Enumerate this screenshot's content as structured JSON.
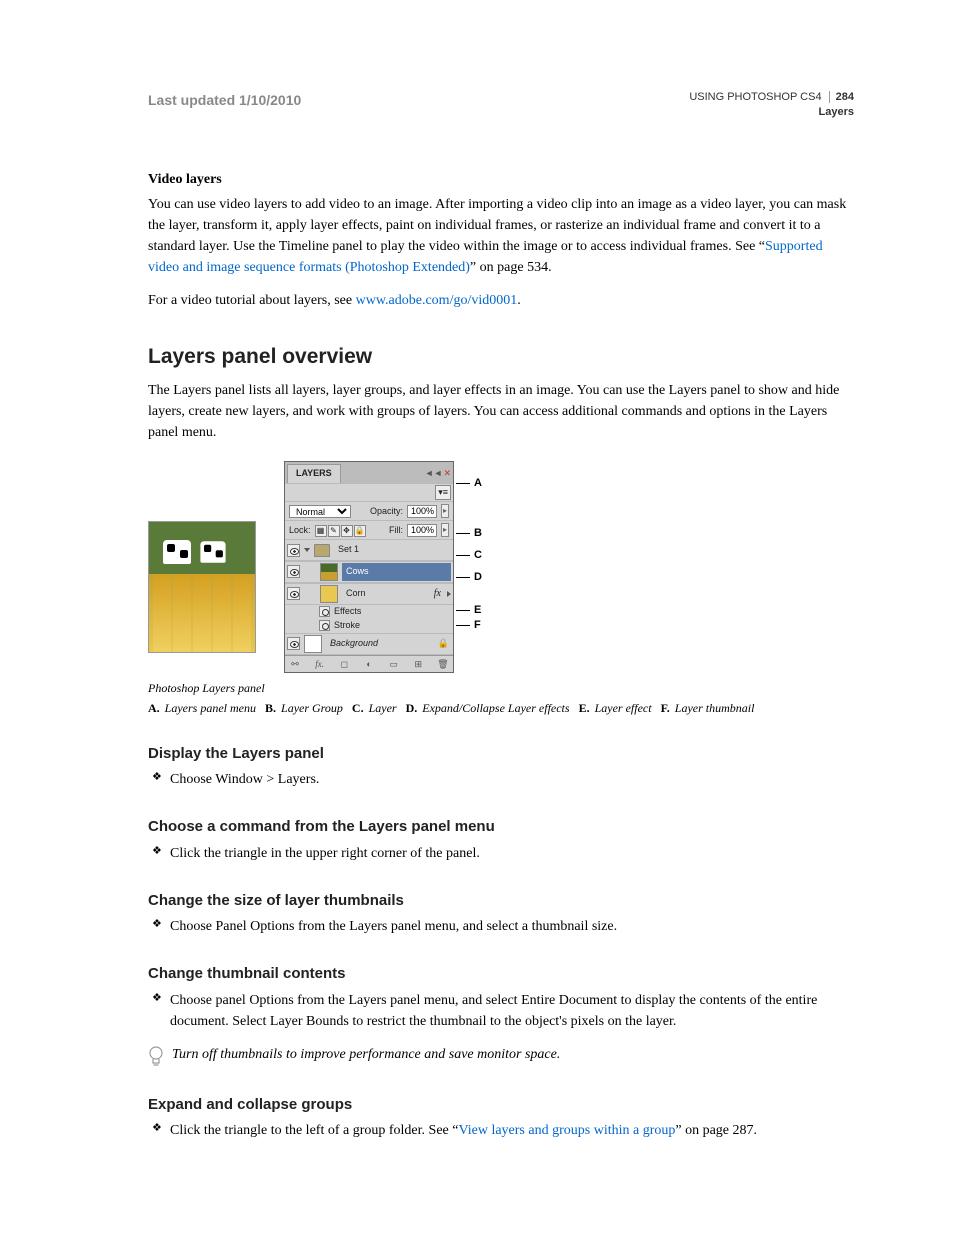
{
  "header": {
    "last_updated": "Last updated 1/10/2010",
    "doc_title": "USING PHOTOSHOP CS4",
    "page_number": "284",
    "section_name": "Layers"
  },
  "video_layers": {
    "heading": "Video layers",
    "para1_a": "You can use video layers to add video to an image. After importing a video clip into an image as a video layer, you can mask the layer, transform it, apply layer effects, paint on individual frames, or rasterize an individual frame and convert it to a standard layer. Use the Timeline panel to play the video within the image or to access individual frames. See “",
    "link1": "Supported video and image sequence formats (Photoshop Extended)",
    "para1_b": "” on page 534.",
    "para2_a": "For a video tutorial about layers, see ",
    "link2": "www.adobe.com/go/vid0001",
    "para2_b": "."
  },
  "overview": {
    "heading": "Layers panel overview",
    "para": "The Layers panel lists all layers, layer groups, and layer effects in an image. You can use the Layers panel to show and hide layers, create new layers, and work with groups of layers. You can access additional commands and options in the Layers panel menu."
  },
  "layers_panel": {
    "tab": "LAYERS",
    "blend_mode": "Normal",
    "opacity_label": "Opacity:",
    "opacity_value": "100%",
    "lock_label": "Lock:",
    "fill_label": "Fill:",
    "fill_value": "100%",
    "group_name": "Set 1",
    "layer_cows": "Cows",
    "layer_corn": "Corn",
    "effects_label": "Effects",
    "stroke_label": "Stroke",
    "background_label": "Background",
    "fx_glyph": "fx"
  },
  "callout_labels": {
    "a": "A",
    "b": "B",
    "c": "C",
    "d": "D",
    "e": "E",
    "f": "F"
  },
  "figure": {
    "caption": "Photoshop Layers panel",
    "legend": {
      "a_label": "A.",
      "a_text": "Layers panel menu",
      "b_label": "B.",
      "b_text": "Layer Group",
      "c_label": "C.",
      "c_text": "Layer",
      "d_label": "D.",
      "d_text": "Expand/Collapse Layer effects",
      "e_label": "E.",
      "e_text": "Layer effect",
      "f_label": "F.",
      "f_text": "Layer thumbnail"
    }
  },
  "display": {
    "heading": "Display the Layers panel",
    "item": "Choose Window > Layers."
  },
  "command": {
    "heading": "Choose a command from the Layers panel menu",
    "item": "Click the triangle in the upper right corner of the panel."
  },
  "thumbsize": {
    "heading": "Change the size of layer thumbnails",
    "item": "Choose Panel Options from the Layers panel menu, and select a thumbnail size."
  },
  "thumbcontent": {
    "heading": "Change thumbnail contents",
    "item": "Choose panel Options from the Layers panel menu, and select Entire Document to display the contents of the entire document. Select Layer Bounds to restrict the thumbnail to the object's pixels on the layer.",
    "tip": "Turn off thumbnails to improve performance and save monitor space."
  },
  "expand": {
    "heading": "Expand and collapse groups",
    "item_a": "Click the triangle to the left of a group folder. See “",
    "link": "View layers and groups within a group",
    "item_b": "” on page 287."
  }
}
